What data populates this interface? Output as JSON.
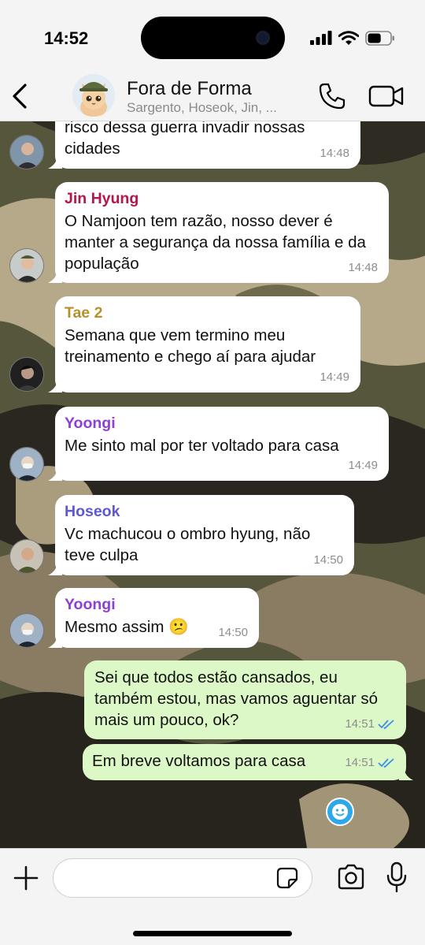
{
  "status_bar": {
    "time": "14:52",
    "battery_level": 0.6
  },
  "header": {
    "title": "Fora de Forma",
    "subtitle": "Sargento, Hoseok, Jin, ...",
    "icons": [
      "back-chevron-icon",
      "phone-icon",
      "video-camera-icon"
    ]
  },
  "colors": {
    "outgoing_bubble": "#dcf8c6",
    "incoming_bubble": "#ffffff",
    "read_ticks": "#3b8fe8",
    "name_jin": "#b0174f",
    "name_tae": "#b8902a",
    "name_yoongi": "#8f3fd6",
    "name_hoseok": "#5e57d6"
  },
  "messages": [
    {
      "text": "risco dessa guerra invadir nossas cidades",
      "time": "14:48"
    },
    {
      "sender": "Jin Hyung",
      "text": "O Namjoon tem razão, nosso dever é manter a segurança da nossa família e da população",
      "time": "14:48"
    },
    {
      "sender": "Tae 2",
      "text": "Semana que vem termino meu treinamento e chego aí para ajudar",
      "time": "14:49"
    },
    {
      "sender": "Yoongi",
      "text": "Me sinto mal por ter voltado para casa",
      "time": "14:49"
    },
    {
      "sender": "Hoseok",
      "text": "Vc machucou o ombro hyung, não teve culpa",
      "time": "14:50"
    },
    {
      "sender": "Yoongi",
      "text": "Mesmo assim 😕",
      "time": "14:50"
    },
    {
      "text": "Sei que todos estão cansados, eu também estou, mas vamos aguentar só mais um pouco, ok?",
      "time": "14:51",
      "status": "read"
    },
    {
      "text": "Em breve voltamos para casa",
      "time": "14:51",
      "status": "read"
    }
  ],
  "input": {
    "placeholder": ""
  },
  "input_icons": [
    "plus-icon",
    "sticker-icon",
    "camera-icon",
    "microphone-icon"
  ]
}
